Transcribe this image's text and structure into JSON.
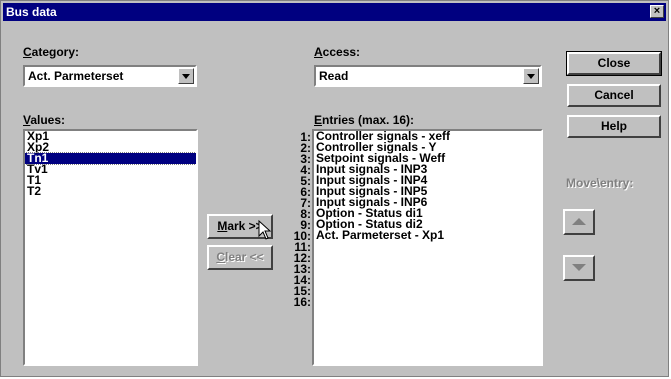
{
  "window": {
    "title": "Bus data",
    "close_glyph": "×"
  },
  "category": {
    "label_key": "C",
    "label_rest": "ategory:",
    "value": "Act. Parmeterset"
  },
  "access": {
    "label_key": "A",
    "label_rest": "ccess:",
    "value": "Read"
  },
  "values": {
    "label_key": "V",
    "label_rest": "alues:",
    "items": [
      "Xp1",
      "Xp2",
      "Tn1",
      "Tv1",
      "T1",
      "T2"
    ],
    "selected_index": 2
  },
  "entries": {
    "label_key": "E",
    "label_rest": "ntries (max. 16):",
    "numbers": [
      "1:",
      "2:",
      "3:",
      "4:",
      "5:",
      "6:",
      "7:",
      "8:",
      "9:",
      "10:",
      "11:",
      "12:",
      "13:",
      "14:",
      "15:",
      "16:"
    ],
    "items": [
      "Controller signals - xeff",
      "Controller signals - Y",
      "Setpoint signals - Weff",
      "Input signals - INP3",
      "Input signals - INP4",
      "Input signals - INP5",
      "Input signals - INP6",
      "Option - Status di1",
      "Option - Status di2",
      "Act. Parmeterset - Xp1"
    ]
  },
  "buttons": {
    "mark_key": "M",
    "mark_rest": "ark >>",
    "clear_key": "C",
    "clear_rest": "lear <<",
    "close": "Close",
    "cancel": "Cancel",
    "help": "Help"
  },
  "move_entry_label": "Move\\entry:",
  "icons": {
    "move_up": "triangle-up-icon",
    "move_down": "triangle-down-icon",
    "pointer": "mouse-pointer-icon"
  }
}
